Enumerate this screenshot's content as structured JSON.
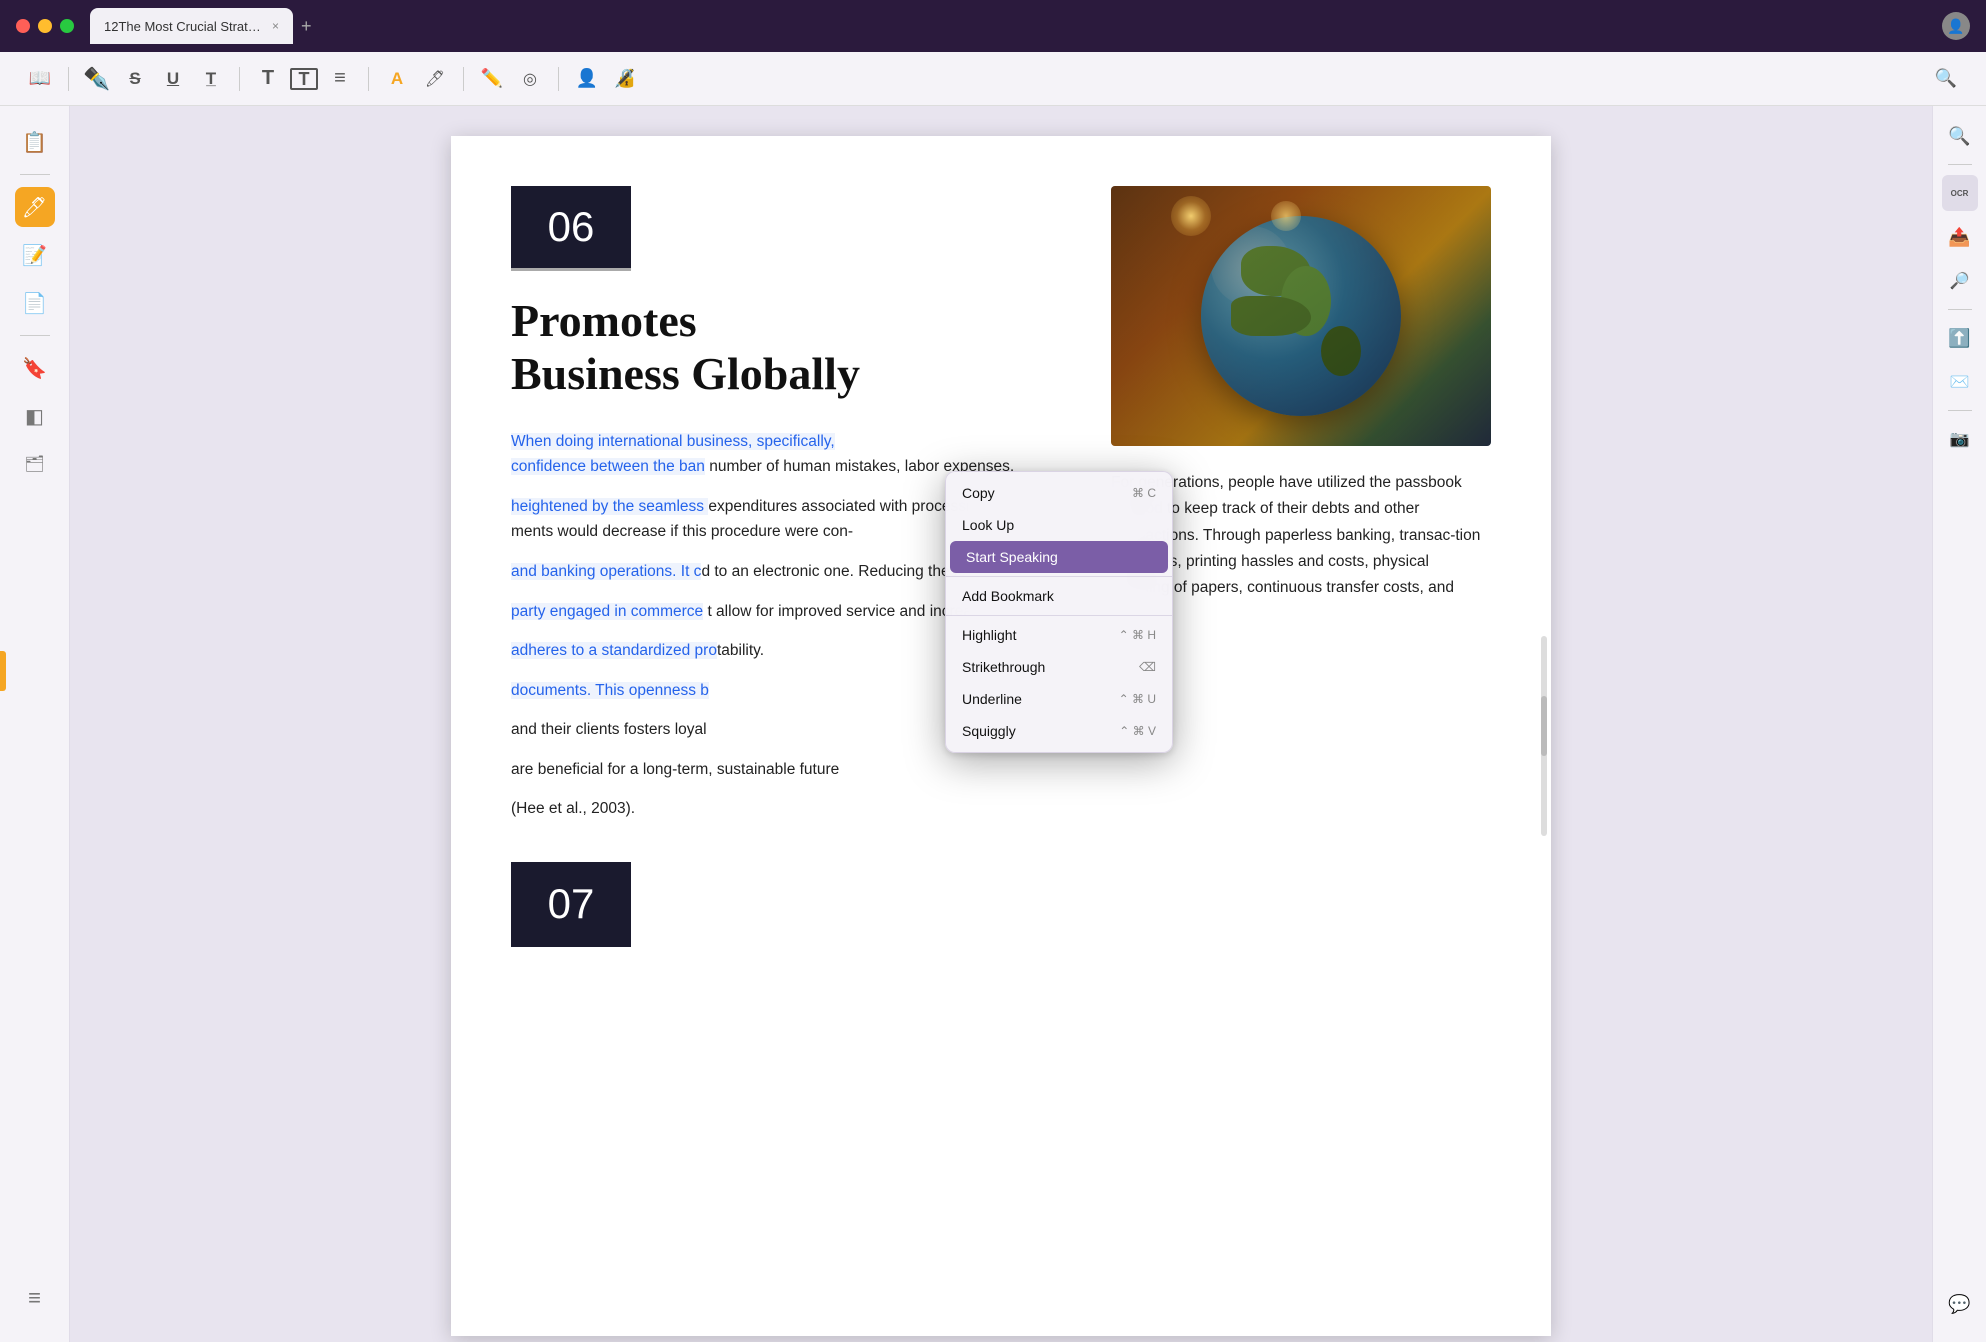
{
  "titlebar": {
    "tab_title": "12The Most Crucial Strate...",
    "close_tab": "×",
    "add_tab": "+"
  },
  "toolbar": {
    "icons": [
      {
        "name": "reader-icon",
        "symbol": "📖"
      },
      {
        "name": "pen-icon",
        "symbol": "✒"
      },
      {
        "name": "strikethrough-icon",
        "symbol": "S̶"
      },
      {
        "name": "underline-icon",
        "symbol": "U̲"
      },
      {
        "name": "text-icon",
        "symbol": "T̲"
      },
      {
        "name": "bold-text-icon",
        "symbol": "𝐓"
      },
      {
        "name": "textbox-icon",
        "symbol": "⊡"
      },
      {
        "name": "list-icon",
        "symbol": "≡"
      },
      {
        "name": "highlight-color-icon",
        "symbol": "A"
      },
      {
        "name": "background-color-icon",
        "symbol": "🖊"
      },
      {
        "name": "pen-tool-icon",
        "symbol": "✏"
      },
      {
        "name": "circle-tool-icon",
        "symbol": "◎"
      },
      {
        "name": "person-icon",
        "symbol": "👤"
      },
      {
        "name": "stamp-icon",
        "symbol": "🔏"
      },
      {
        "name": "search-icon",
        "symbol": "🔍"
      }
    ]
  },
  "left_sidebar": {
    "icons": [
      {
        "name": "reader-panel-icon",
        "symbol": "📋",
        "active": false
      },
      {
        "name": "highlight-tool-icon",
        "symbol": "🖊",
        "active": true
      },
      {
        "name": "annotation-icon",
        "symbol": "📝",
        "active": false
      },
      {
        "name": "pages-icon",
        "symbol": "📄",
        "active": false
      },
      {
        "name": "bookmarks-icon",
        "symbol": "🔖",
        "active": false
      },
      {
        "name": "layers-icon",
        "symbol": "◧",
        "active": false
      },
      {
        "name": "stamp-panel-icon",
        "symbol": "🗂",
        "active": false
      }
    ]
  },
  "pdf_content": {
    "chapter_06_number": "06",
    "chapter_06_title": "Promotes\nBusiness Globally",
    "body_text_left_normal": "When doing international business, specifically,",
    "body_text_left_highlighted": "confidence between the ban",
    "body_text_left_highlighted_2": "heightened by the seamless",
    "body_text_left_continued": "and banking operations. It c",
    "body_text_left_4": "party engaged in commerce",
    "body_text_left_5": "adheres to a standardized pro",
    "body_text_left_6": "documents. This openness b",
    "body_text_left_7": "and their clients fosters loyal",
    "body_text_left_8": "are beneficial for a long-term, sustainable future",
    "body_text_left_9": "(Hee et al., 2003).",
    "right_col_1": "number of human mistakes, labor expenses,",
    "right_col_2": "expenditures associated with processing docu-",
    "right_col_3": "ments would decrease if this procedure were con-",
    "right_col_4": "d to an electronic one. Reducing these costs",
    "right_col_5": "t allow for improved service and increased",
    "right_col_6": "tability.",
    "right_col_gen": "For generations, people have utilized the passbook",
    "right_col_gen_2": "method to keep track of their debts and other",
    "right_col_gen_3": "transactions. Through paperless banking, transac-",
    "right_col_gen_4": "tion expenses, printing hassles and costs, physical",
    "right_col_gen_5": "handling of papers, continuous transfer costs, and",
    "chapter_07_number": "07"
  },
  "context_menu": {
    "items": [
      {
        "label": "Copy",
        "shortcut": "⌘ C",
        "active": false
      },
      {
        "label": "Look Up",
        "shortcut": "",
        "active": false
      },
      {
        "label": "Start Speaking",
        "shortcut": "",
        "active": true
      },
      {
        "label": "Add Bookmark",
        "shortcut": "",
        "active": false
      },
      {
        "label": "Highlight",
        "shortcut": "⌃ ⌘ H",
        "active": false
      },
      {
        "label": "Strikethrough",
        "shortcut": "⌫",
        "active": false
      },
      {
        "label": "Underline",
        "shortcut": "⌃ ⌘ U",
        "active": false
      },
      {
        "label": "Squiggly",
        "shortcut": "⌃ ⌘ V",
        "active": false
      }
    ]
  },
  "right_sidebar": {
    "icons": [
      {
        "name": "ocr-icon",
        "symbol": "OCR"
      },
      {
        "name": "export-icon",
        "symbol": "↗"
      },
      {
        "name": "search-pdf-icon",
        "symbol": "🔍"
      },
      {
        "name": "share-icon",
        "symbol": "⬆"
      },
      {
        "name": "email-icon",
        "symbol": "✉"
      },
      {
        "name": "camera-icon",
        "symbol": "📷"
      },
      {
        "name": "comment-icon",
        "symbol": "💬"
      }
    ]
  },
  "colors": {
    "accent_orange": "#f5a623",
    "active_menu": "#7b5ea7",
    "highlight_blue": "#2563eb",
    "dark_bg": "#1a1a2e",
    "sidebar_bg": "#f5f3f8"
  }
}
